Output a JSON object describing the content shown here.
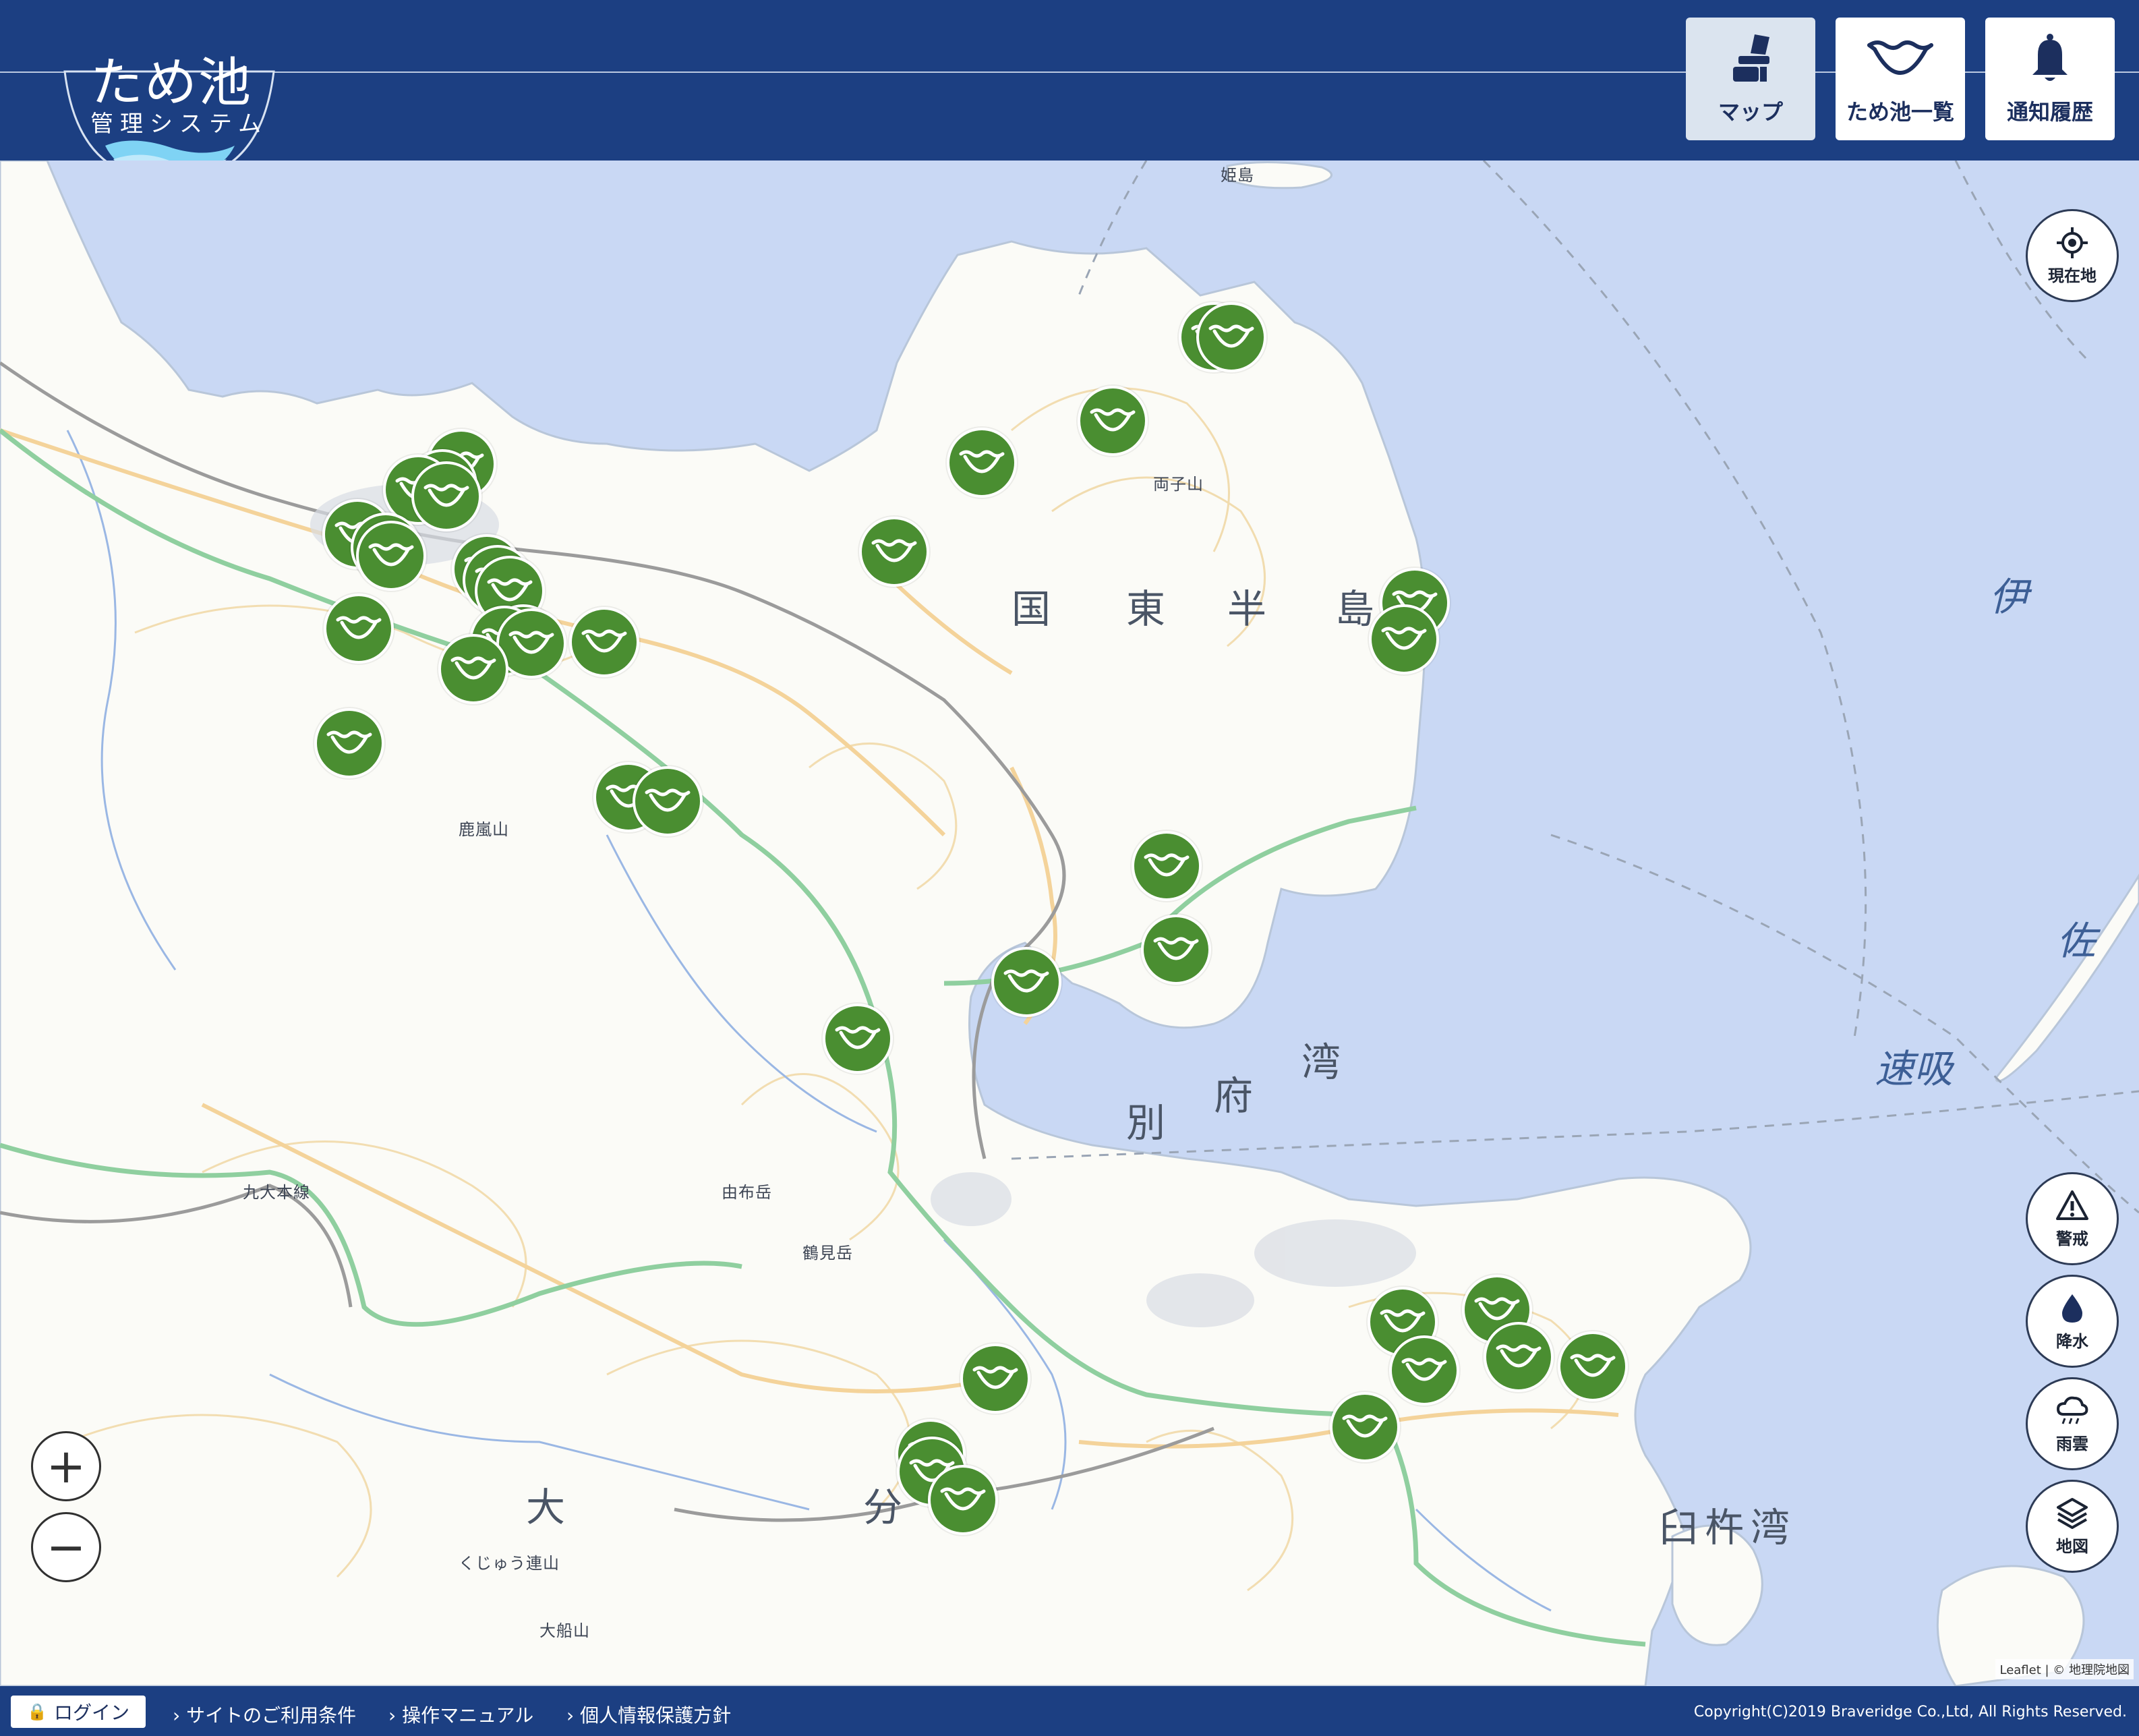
{
  "header": {
    "logo_title": "ため池",
    "logo_subtitle": "管理システム",
    "nav": [
      {
        "label": "マップ",
        "icon": "chair-icon",
        "active": true
      },
      {
        "label": "ため池一覧",
        "icon": "pond-icon",
        "active": false
      },
      {
        "label": "通知履歴",
        "icon": "bell-icon",
        "active": false
      }
    ]
  },
  "map": {
    "places": {
      "kunisaki_1": "国",
      "kunisaki_2": "東",
      "kunisaki_3": "半",
      "kunisaki_4": "島",
      "oita_1": "大",
      "oita_2": "分",
      "beppu_1": "別",
      "beppu_2": "府",
      "beppu_3": "湾",
      "usuki_bay": "臼杵湾",
      "kyudai": "九大本線",
      "tsurumidake": "鶴見岳",
      "yufudake": "由布岳",
      "hojyo": "速吸",
      "iyo": "伊",
      "sa": "佐",
      "kuju": "くじゅう連山",
      "oofunayama": "大船山",
      "kasayama": "鹿嵐山",
      "futagoyama": "両子山",
      "himeshima": "姫島"
    },
    "markers_count": 36,
    "controls": [
      {
        "label": "現在地",
        "icon": "location-icon"
      },
      {
        "label": "警戒",
        "icon": "warning-icon"
      },
      {
        "label": "降水",
        "icon": "raindrop-icon"
      },
      {
        "label": "雨雲",
        "icon": "cloud-rain-icon"
      },
      {
        "label": "地図",
        "icon": "layers-icon"
      }
    ],
    "zoom_in": "+",
    "zoom_out": "−",
    "attribution": "Leaflet | © 地理院地図"
  },
  "footer": {
    "login": "ログイン",
    "links": [
      "サイトのご利用条件",
      "操作マニュアル",
      "個人情報保護方針"
    ],
    "copyright": "Copyright(C)2019 Braveridge Co.,Ltd, All Rights Reserved."
  },
  "colors": {
    "header": "#1c3f82",
    "sea": "#c9d8f4",
    "land": "#fbfbf7",
    "marker": "#4a8e31"
  }
}
